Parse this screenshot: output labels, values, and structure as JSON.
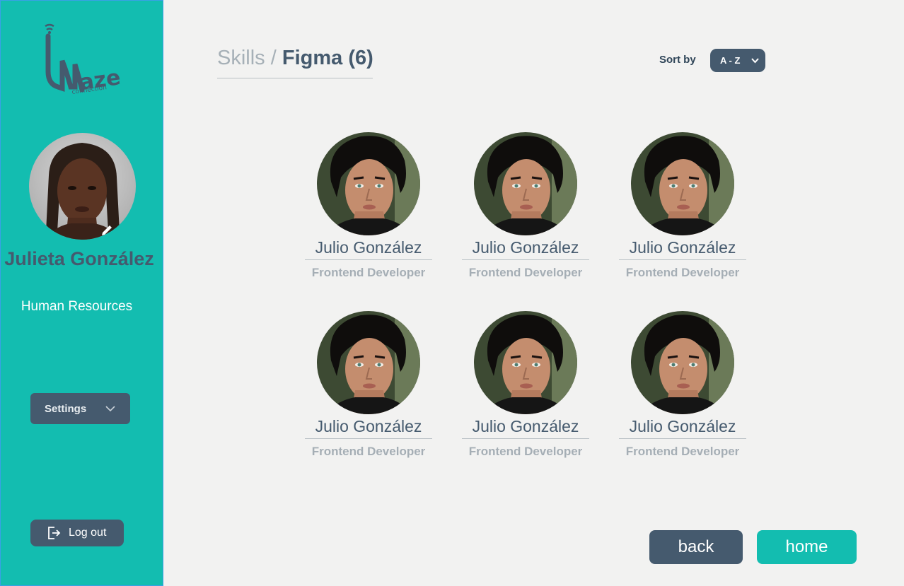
{
  "sidebar": {
    "logo_text": "maze",
    "logo_subtext": "connection",
    "user": {
      "name": "Julieta González",
      "role": "Human Resources"
    },
    "settings_label": "Settings",
    "logout_label": "Log out"
  },
  "header": {
    "breadcrumb_parent": "Skills",
    "separator": "/",
    "current": "Figma (6)",
    "sort_label": "Sort by",
    "sort_value": "A - Z"
  },
  "people": [
    {
      "name": "Julio González",
      "role": "Frontend Developer"
    },
    {
      "name": "Julio González",
      "role": "Frontend Developer"
    },
    {
      "name": "Julio González",
      "role": "Frontend Developer"
    },
    {
      "name": "Julio González",
      "role": "Frontend Developer"
    },
    {
      "name": "Julio González",
      "role": "Frontend Developer"
    },
    {
      "name": "Julio González",
      "role": "Frontend Developer"
    }
  ],
  "footer": {
    "back_label": "back",
    "home_label": "home"
  },
  "colors": {
    "teal": "#13bdb0",
    "slate": "#455a6e",
    "background": "#f2f2f1"
  }
}
